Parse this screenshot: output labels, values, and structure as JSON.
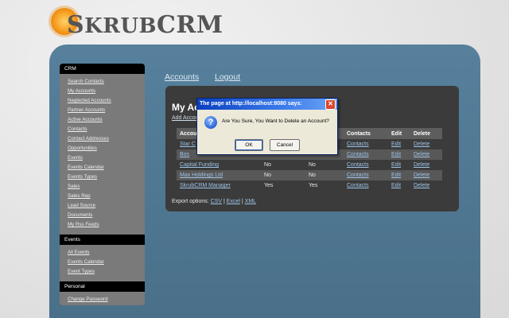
{
  "logo": {
    "first_letter": "S",
    "rest": "KRUB",
    "crm": "CRM"
  },
  "top_nav": {
    "accounts": "Accounts",
    "logout": "Logout"
  },
  "sidebar": {
    "crm_header": "CRM",
    "crm_items": [
      "Search Contacts",
      "My Accounts",
      "Neglected Accounts",
      "Partner Accounts",
      "Active Accounts",
      "Contacts",
      "Contact Addresses",
      "Opportunities",
      "Events",
      "Events Calendar",
      "Events Types",
      "Sales",
      "Sales Rep",
      "Lead Source",
      "Documents",
      "My Rss Feeds"
    ],
    "events_header": "Events",
    "events_items": [
      "All Events",
      "Events Calendar",
      "Event Types"
    ],
    "personal_header": "Personal",
    "personal_items": [
      "Change Password"
    ]
  },
  "content": {
    "title": "My Ac",
    "add_link": "Add Accou",
    "columns": {
      "account": "Accou",
      "contacts": "Contacts",
      "edit": "Edit",
      "delete": "Delete"
    },
    "rows": [
      {
        "name": "Star C",
        "a": "",
        "b": "",
        "contacts": "Contacts",
        "edit": "Edit",
        "delete": "Delete"
      },
      {
        "name": "Bos",
        "a": "",
        "b": "",
        "contacts": "Contacts",
        "edit": "Edit",
        "delete": "Delete"
      },
      {
        "name": "Capital Funding",
        "a": "No",
        "b": "No",
        "contacts": "Contacts",
        "edit": "Edit",
        "delete": "Delete"
      },
      {
        "name": "Max Holdings Ltd",
        "a": "No",
        "b": "No",
        "contacts": "Contacts",
        "edit": "Edit",
        "delete": "Delete"
      },
      {
        "name": "SkrubCRM Manager",
        "a": "Yes",
        "b": "Yes",
        "contacts": "Contacts",
        "edit": "Edit",
        "delete": "Delete"
      }
    ],
    "export_label": "Export options:",
    "export_csv": "CSV",
    "export_excel": "Excel",
    "export_xml": "XML",
    "sep": "|"
  },
  "dialog": {
    "title": "The page at http://localhost:8080 says:",
    "close": "✕",
    "message": "Are You Sure, You Want to Delete an Account?",
    "ok": "OK",
    "cancel": "Cancel",
    "icon": "question-icon"
  }
}
